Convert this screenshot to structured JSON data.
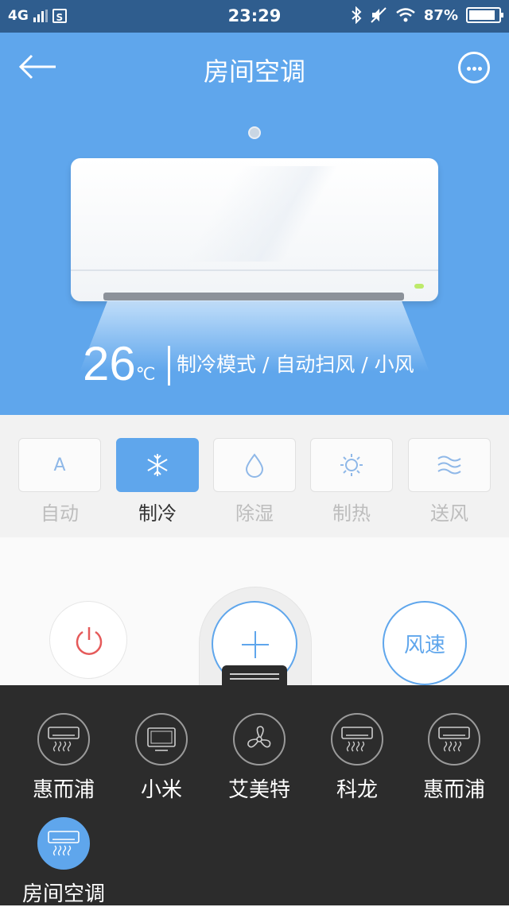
{
  "status": {
    "network": "4G",
    "time": "23:29",
    "battery": "87%"
  },
  "header": {
    "title": "房间空调"
  },
  "state": {
    "temperature": "26",
    "unit": "℃",
    "mode_text": "制冷模式 / 自动扫风 / 小风"
  },
  "modes": [
    {
      "label": "自动",
      "icon": "A",
      "active": false
    },
    {
      "label": "制冷",
      "icon": "❄",
      "active": true
    },
    {
      "label": "除湿",
      "icon": "💧",
      "active": false
    },
    {
      "label": "制热",
      "icon": "☼",
      "active": false
    },
    {
      "label": "送风",
      "icon": "≋",
      "active": false
    }
  ],
  "controls": {
    "speed_label": "风速"
  },
  "devices": [
    {
      "label": "惠而浦",
      "icon": "aircon-icon"
    },
    {
      "label": "小米",
      "icon": "tv-icon"
    },
    {
      "label": "艾美特",
      "icon": "fan-icon"
    },
    {
      "label": "科龙",
      "icon": "aircon-icon"
    },
    {
      "label": "惠而浦",
      "icon": "aircon-icon"
    },
    {
      "label": "房间空调",
      "icon": "aircon-icon",
      "active": true
    }
  ],
  "colors": {
    "accent": "#5fa6ec",
    "statusbar": "#2f5d8e",
    "drawer": "#2c2c2c",
    "power": "#e55a5a"
  }
}
